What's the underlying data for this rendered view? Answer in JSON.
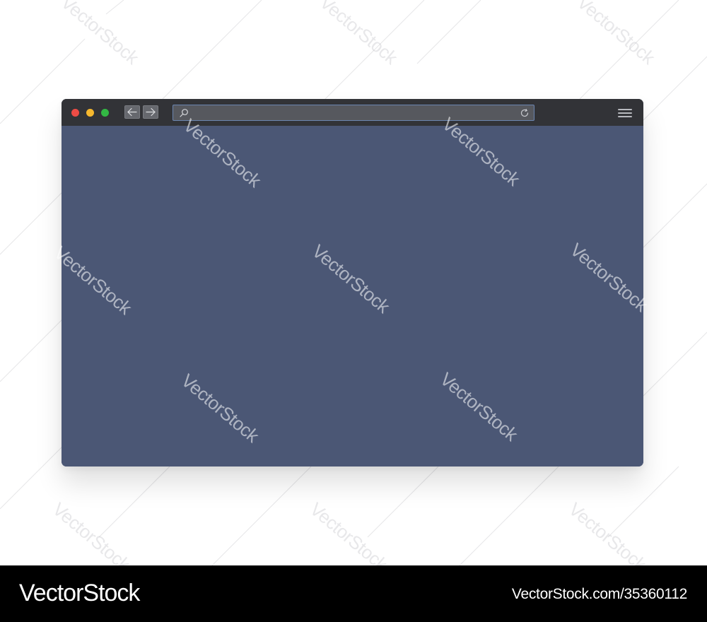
{
  "browser_window": {
    "traffic_lights": {
      "close_color": "#ee4c45",
      "minimize_color": "#f6b82e",
      "maximize_color": "#33b844"
    },
    "nav": {
      "back_icon": "arrow-left-icon",
      "forward_icon": "arrow-right-icon"
    },
    "address_bar": {
      "value": "",
      "placeholder": "",
      "search_icon": "magnifier-icon",
      "reload_icon": "reload-icon"
    },
    "menu_icon": "hamburger-menu-icon",
    "colors": {
      "toolbar": "#323337",
      "content": "#4b5775",
      "address_border": "#6b85b0"
    }
  },
  "watermark": {
    "text": "VectorStock"
  },
  "footer": {
    "brand": "VectorStock",
    "image_id": "VectorStock.com/35360112"
  }
}
